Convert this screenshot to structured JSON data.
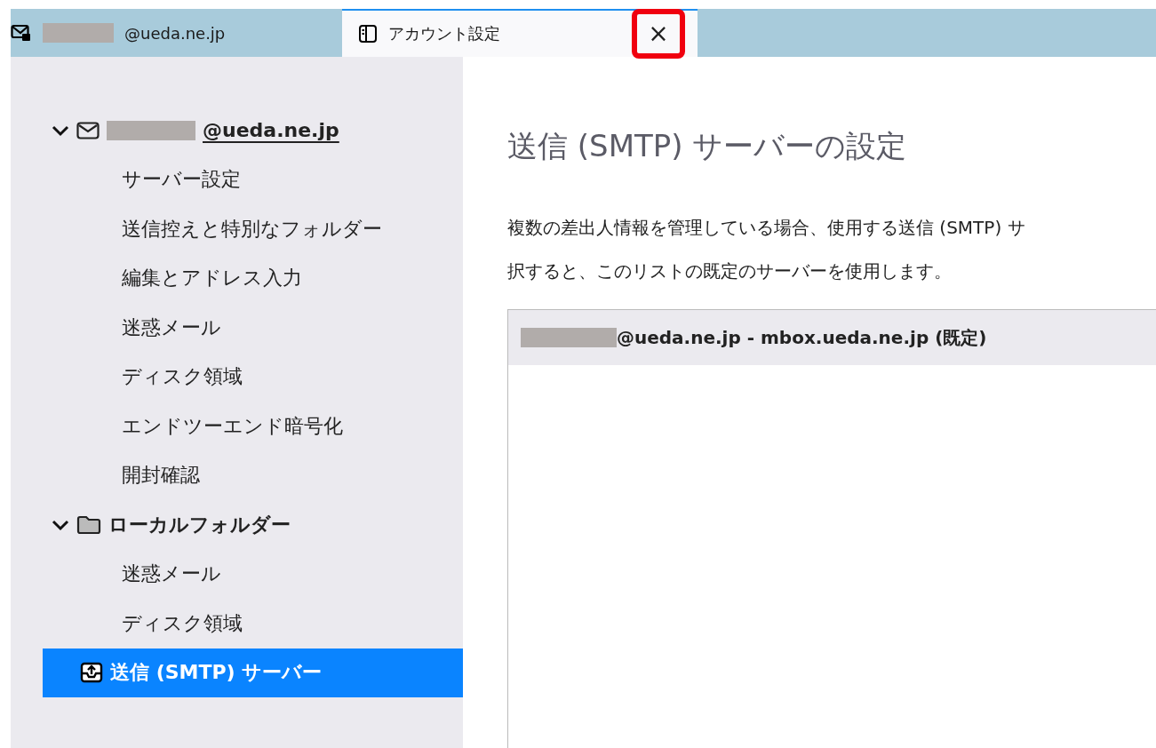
{
  "tabs": [
    {
      "label": "@ueda.ne.jp",
      "kind": "mailbox",
      "selected": false
    },
    {
      "label": "アカウント設定",
      "kind": "settings",
      "selected": true
    }
  ],
  "close_button": {
    "label": "×",
    "highlighted": true
  },
  "sidebar": {
    "items": [
      {
        "label": "@ueda.ne.jp",
        "kind": "account",
        "expanded": true,
        "selected": false,
        "children": [
          {
            "label": "サーバー設定",
            "selected": false
          },
          {
            "label": "送信控えと特別なフォルダー",
            "selected": false
          },
          {
            "label": "編集とアドレス入力",
            "selected": false
          },
          {
            "label": "迷惑メール",
            "selected": false
          },
          {
            "label": "ディスク領域",
            "selected": false
          },
          {
            "label": "エンドツーエンド暗号化",
            "selected": false
          },
          {
            "label": "開封確認",
            "selected": false
          }
        ]
      },
      {
        "label": "ローカルフォルダー",
        "kind": "folder",
        "expanded": true,
        "selected": false,
        "children": [
          {
            "label": "迷惑メール",
            "selected": false
          },
          {
            "label": "ディスク領域",
            "selected": false
          }
        ]
      },
      {
        "label": "送信 (SMTP) サーバー",
        "kind": "outbox",
        "selected": true
      }
    ]
  },
  "content": {
    "title": "送信 (SMTP) サーバーの設定",
    "description": [
      "複数の差出人情報を管理している場合、使用する送信 (SMTP) サ",
      "択すると、このリストの既定のサーバーを使用します。"
    ],
    "servers": [
      {
        "label": "@ueda.ne.jp - mbox.ueda.ne.jp (既定)",
        "selected": false
      }
    ]
  }
}
